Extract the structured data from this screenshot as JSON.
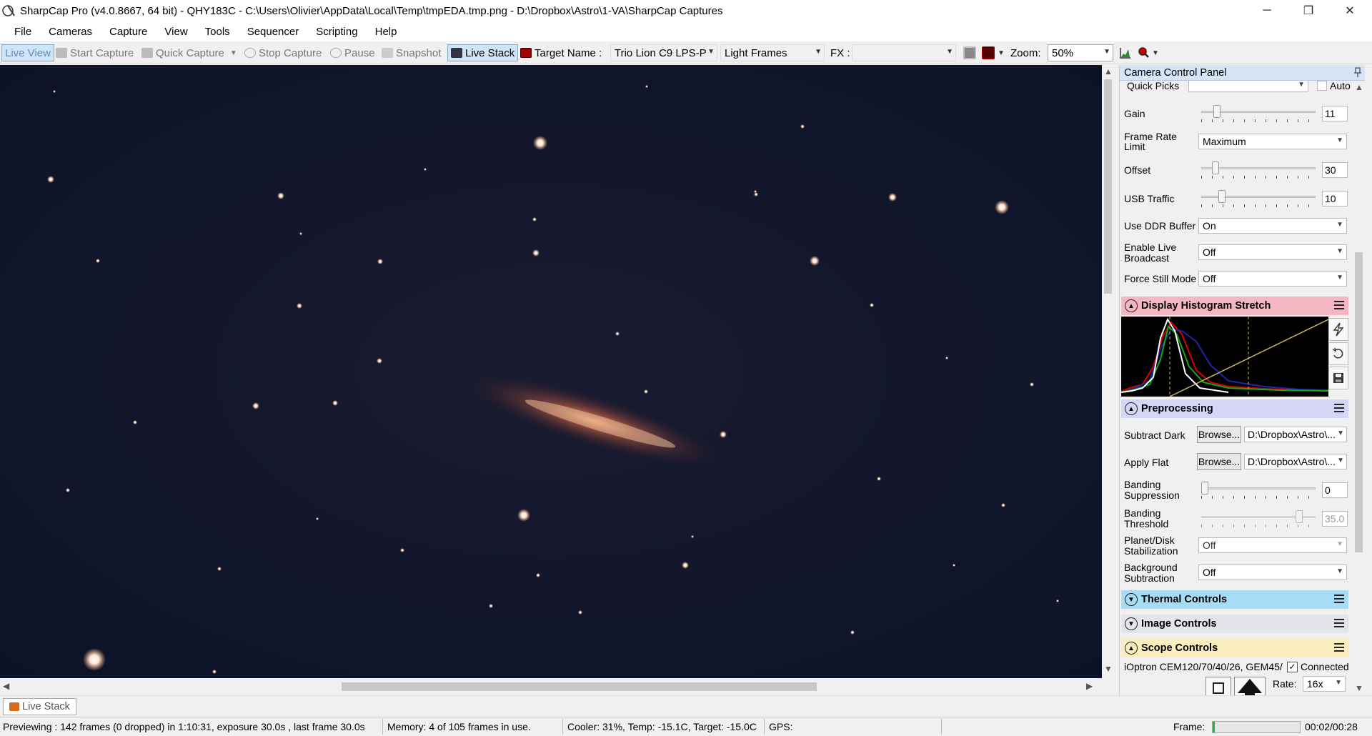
{
  "window": {
    "title": "SharpCap Pro (v4.0.8667, 64 bit) - QHY183C - C:\\Users\\Olivier\\AppData\\Local\\Temp\\tmpEDA.tmp.png - D:\\Dropbox\\Astro\\1-VA\\SharpCap Captures",
    "minimize": "─",
    "maximize": "❐",
    "close": "✕"
  },
  "menu": [
    "File",
    "Cameras",
    "Capture",
    "View",
    "Tools",
    "Sequencer",
    "Scripting",
    "Help"
  ],
  "toolbar": {
    "live_view": "Live View",
    "start_capture": "Start Capture",
    "quick_capture": "Quick Capture",
    "stop_capture": "Stop Capture",
    "pause": "Pause",
    "snapshot": "Snapshot",
    "live_stack": "Live Stack",
    "target_name_label": "Target Name :",
    "target_name_value": "Trio Lion C9 LPS-P",
    "frame_type": "Light Frames",
    "fx_label": "FX :",
    "fx_value": "",
    "zoom_label": "Zoom:",
    "zoom_value": "50%"
  },
  "panel": {
    "title": "Camera Control Panel",
    "quick_picks_label": "Quick Picks",
    "quick_picks_value": "",
    "auto_label": "Auto",
    "gain": {
      "label": "Gain",
      "value": "11",
      "level": 0.11
    },
    "frame_rate": {
      "label1": "Frame Rate",
      "label2": "Limit",
      "value": "Maximum"
    },
    "offset": {
      "label": "Offset",
      "value": "30",
      "level": 0.1
    },
    "usb_traffic": {
      "label": "USB Traffic",
      "value": "10",
      "level": 0.16
    },
    "ddr_buffer": {
      "label": "Use DDR Buffer",
      "value": "On"
    },
    "live_broadcast": {
      "label1": "Enable Live",
      "label2": "Broadcast",
      "value": "Off"
    },
    "force_still": {
      "label": "Force Still Mode",
      "value": "Off"
    },
    "histogram_title": "Display Histogram Stretch",
    "preprocessing_title": "Preprocessing",
    "subtract_dark": {
      "label": "Subtract Dark",
      "browse": "Browse...",
      "path": "D:\\Dropbox\\Astro\\..."
    },
    "apply_flat": {
      "label": "Apply Flat",
      "browse": "Browse...",
      "path": "D:\\Dropbox\\Astro\\..."
    },
    "banding_suppression": {
      "label1": "Banding",
      "label2": "Suppression",
      "value": "0",
      "level": 0.0
    },
    "banding_threshold": {
      "label1": "Banding",
      "label2": "Threshold",
      "value": "35.0",
      "level": 0.88
    },
    "planet_stab": {
      "label1": "Planet/Disk",
      "label2": "Stabilization",
      "value": "Off"
    },
    "bg_subtraction": {
      "label1": "Background",
      "label2": "Subtraction",
      "value": "Off"
    },
    "thermal_title": "Thermal Controls",
    "image_controls_title": "Image Controls",
    "scope_title": "Scope Controls",
    "scope_mount": "iOptron CEM120/70/40/26, GEM45/",
    "connected_label": "Connected",
    "rate_label": "Rate:",
    "rate_value": "16x"
  },
  "bottom_tab": "Live Stack",
  "status": {
    "previewing": "Previewing : 142 frames (0 dropped) in 1:10:31, exposure 30.0s , last frame 30.0s",
    "memory": "Memory: 4 of 105 frames in use.",
    "cooler": "Cooler: 31%, Temp: -15.1C, Target: -15.0C",
    "gps": "GPS:",
    "frame_label": "Frame:",
    "time": "00:02/00:28"
  },
  "colors": {
    "histogram_header": "#f4b6c2",
    "preprocessing_header": "#d5d5f7",
    "thermal_header": "#a7dcf6",
    "image_controls_header": "#e4e4ea",
    "scope_header": "#faeebf",
    "sky": "#0f1428"
  }
}
